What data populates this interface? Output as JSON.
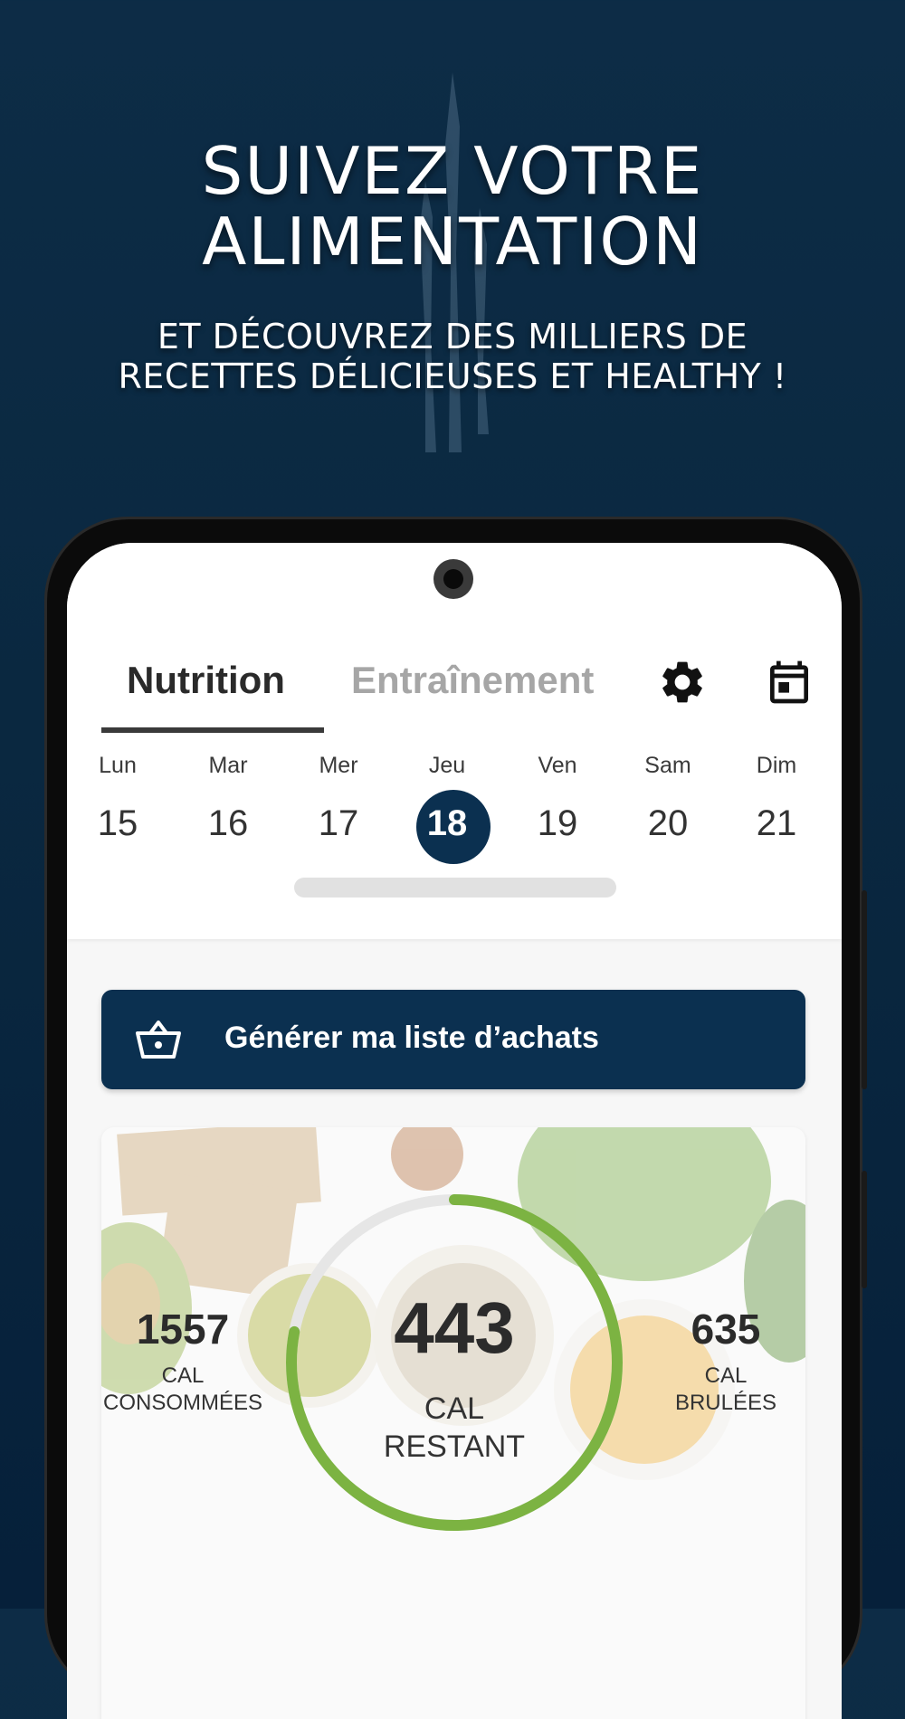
{
  "marketing": {
    "headline_line1": "SUIVEZ VOTRE",
    "headline_line2": "ALIMENTATION",
    "sub_line1": "ET DÉCOUVREZ DES MILLIERS DE",
    "sub_line2": "RECETTES DÉLICIEUSES ET HEALTHY !"
  },
  "tabs": {
    "active": "Nutrition",
    "inactive": "Entraînement"
  },
  "icons": {
    "settings": "gear-icon",
    "calendar": "calendar-icon",
    "basket": "basket-icon"
  },
  "week": {
    "days": [
      {
        "name": "Lun",
        "num": "15"
      },
      {
        "name": "Mar",
        "num": "16"
      },
      {
        "name": "Mer",
        "num": "17"
      },
      {
        "name": "Jeu",
        "num": "18"
      },
      {
        "name": "Ven",
        "num": "19"
      },
      {
        "name": "Sam",
        "num": "20"
      },
      {
        "name": "Dim",
        "num": "21"
      }
    ],
    "selected": "18"
  },
  "shopping": {
    "label": "Générer ma liste d’achats"
  },
  "calories": {
    "consumed_value": "1557",
    "consumed_label_1": "CAL",
    "consumed_label_2": "CONSOMMÉES",
    "remaining_value": "443",
    "remaining_label_1": "CAL",
    "remaining_label_2": "RESTANT",
    "burned_value": "635",
    "burned_label_1": "CAL",
    "burned_label_2": "BRULÉES",
    "progress_fraction": 0.78
  },
  "colors": {
    "brand": "#0b3050",
    "ring_progress": "#7cb342",
    "ring_track": "#e6e6e6"
  }
}
